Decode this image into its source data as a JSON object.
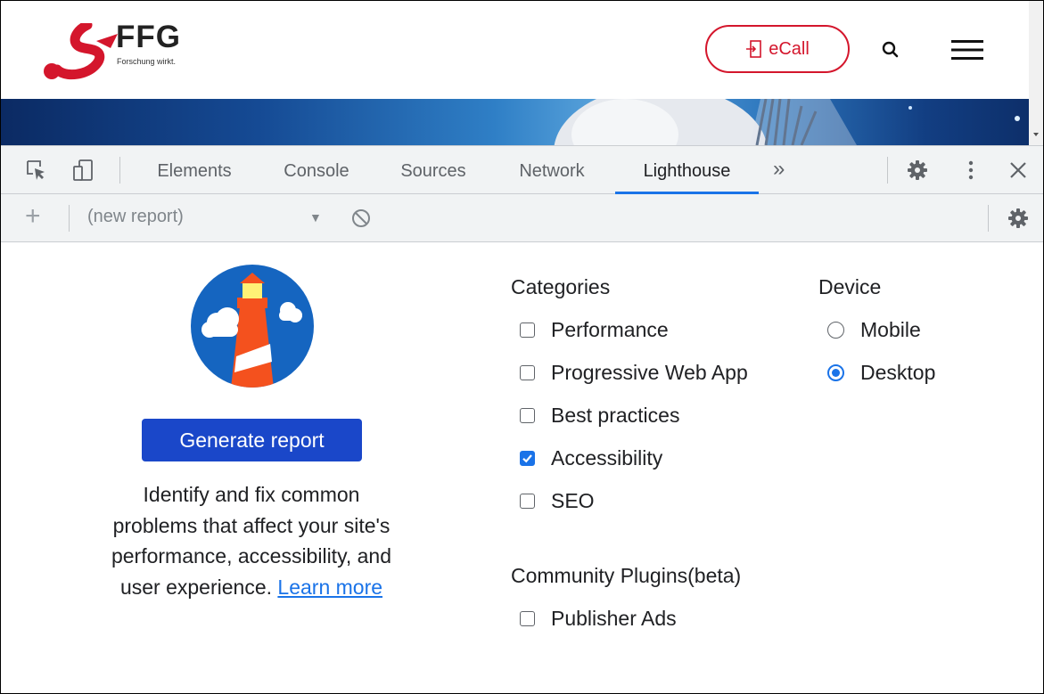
{
  "site": {
    "logo_text": "FFG",
    "logo_tagline": "Forschung wirkt.",
    "ecall_label": "eCall",
    "brand_color": "#d4162c"
  },
  "devtools": {
    "tabs": [
      {
        "label": "Elements",
        "active": false
      },
      {
        "label": "Console",
        "active": false
      },
      {
        "label": "Sources",
        "active": false
      },
      {
        "label": "Network",
        "active": false
      },
      {
        "label": "Lighthouse",
        "active": true
      }
    ],
    "more_tabs": "»",
    "report_select": "(new report)",
    "accent_color": "#1a73e8"
  },
  "lighthouse": {
    "generate_button": "Generate report",
    "description": "Identify and fix common problems that affect your site's performance, accessibility, and user experience.",
    "learn_more": "Learn more",
    "categories_title": "Categories",
    "categories": [
      {
        "label": "Performance",
        "checked": false
      },
      {
        "label": "Progressive Web App",
        "checked": false
      },
      {
        "label": "Best practices",
        "checked": false
      },
      {
        "label": "Accessibility",
        "checked": true
      },
      {
        "label": "SEO",
        "checked": false
      }
    ],
    "plugins_title": "Community Plugins(beta)",
    "plugins": [
      {
        "label": "Publisher Ads",
        "checked": false
      }
    ],
    "device_title": "Device",
    "devices": [
      {
        "label": "Mobile",
        "selected": false
      },
      {
        "label": "Desktop",
        "selected": true
      }
    ]
  }
}
